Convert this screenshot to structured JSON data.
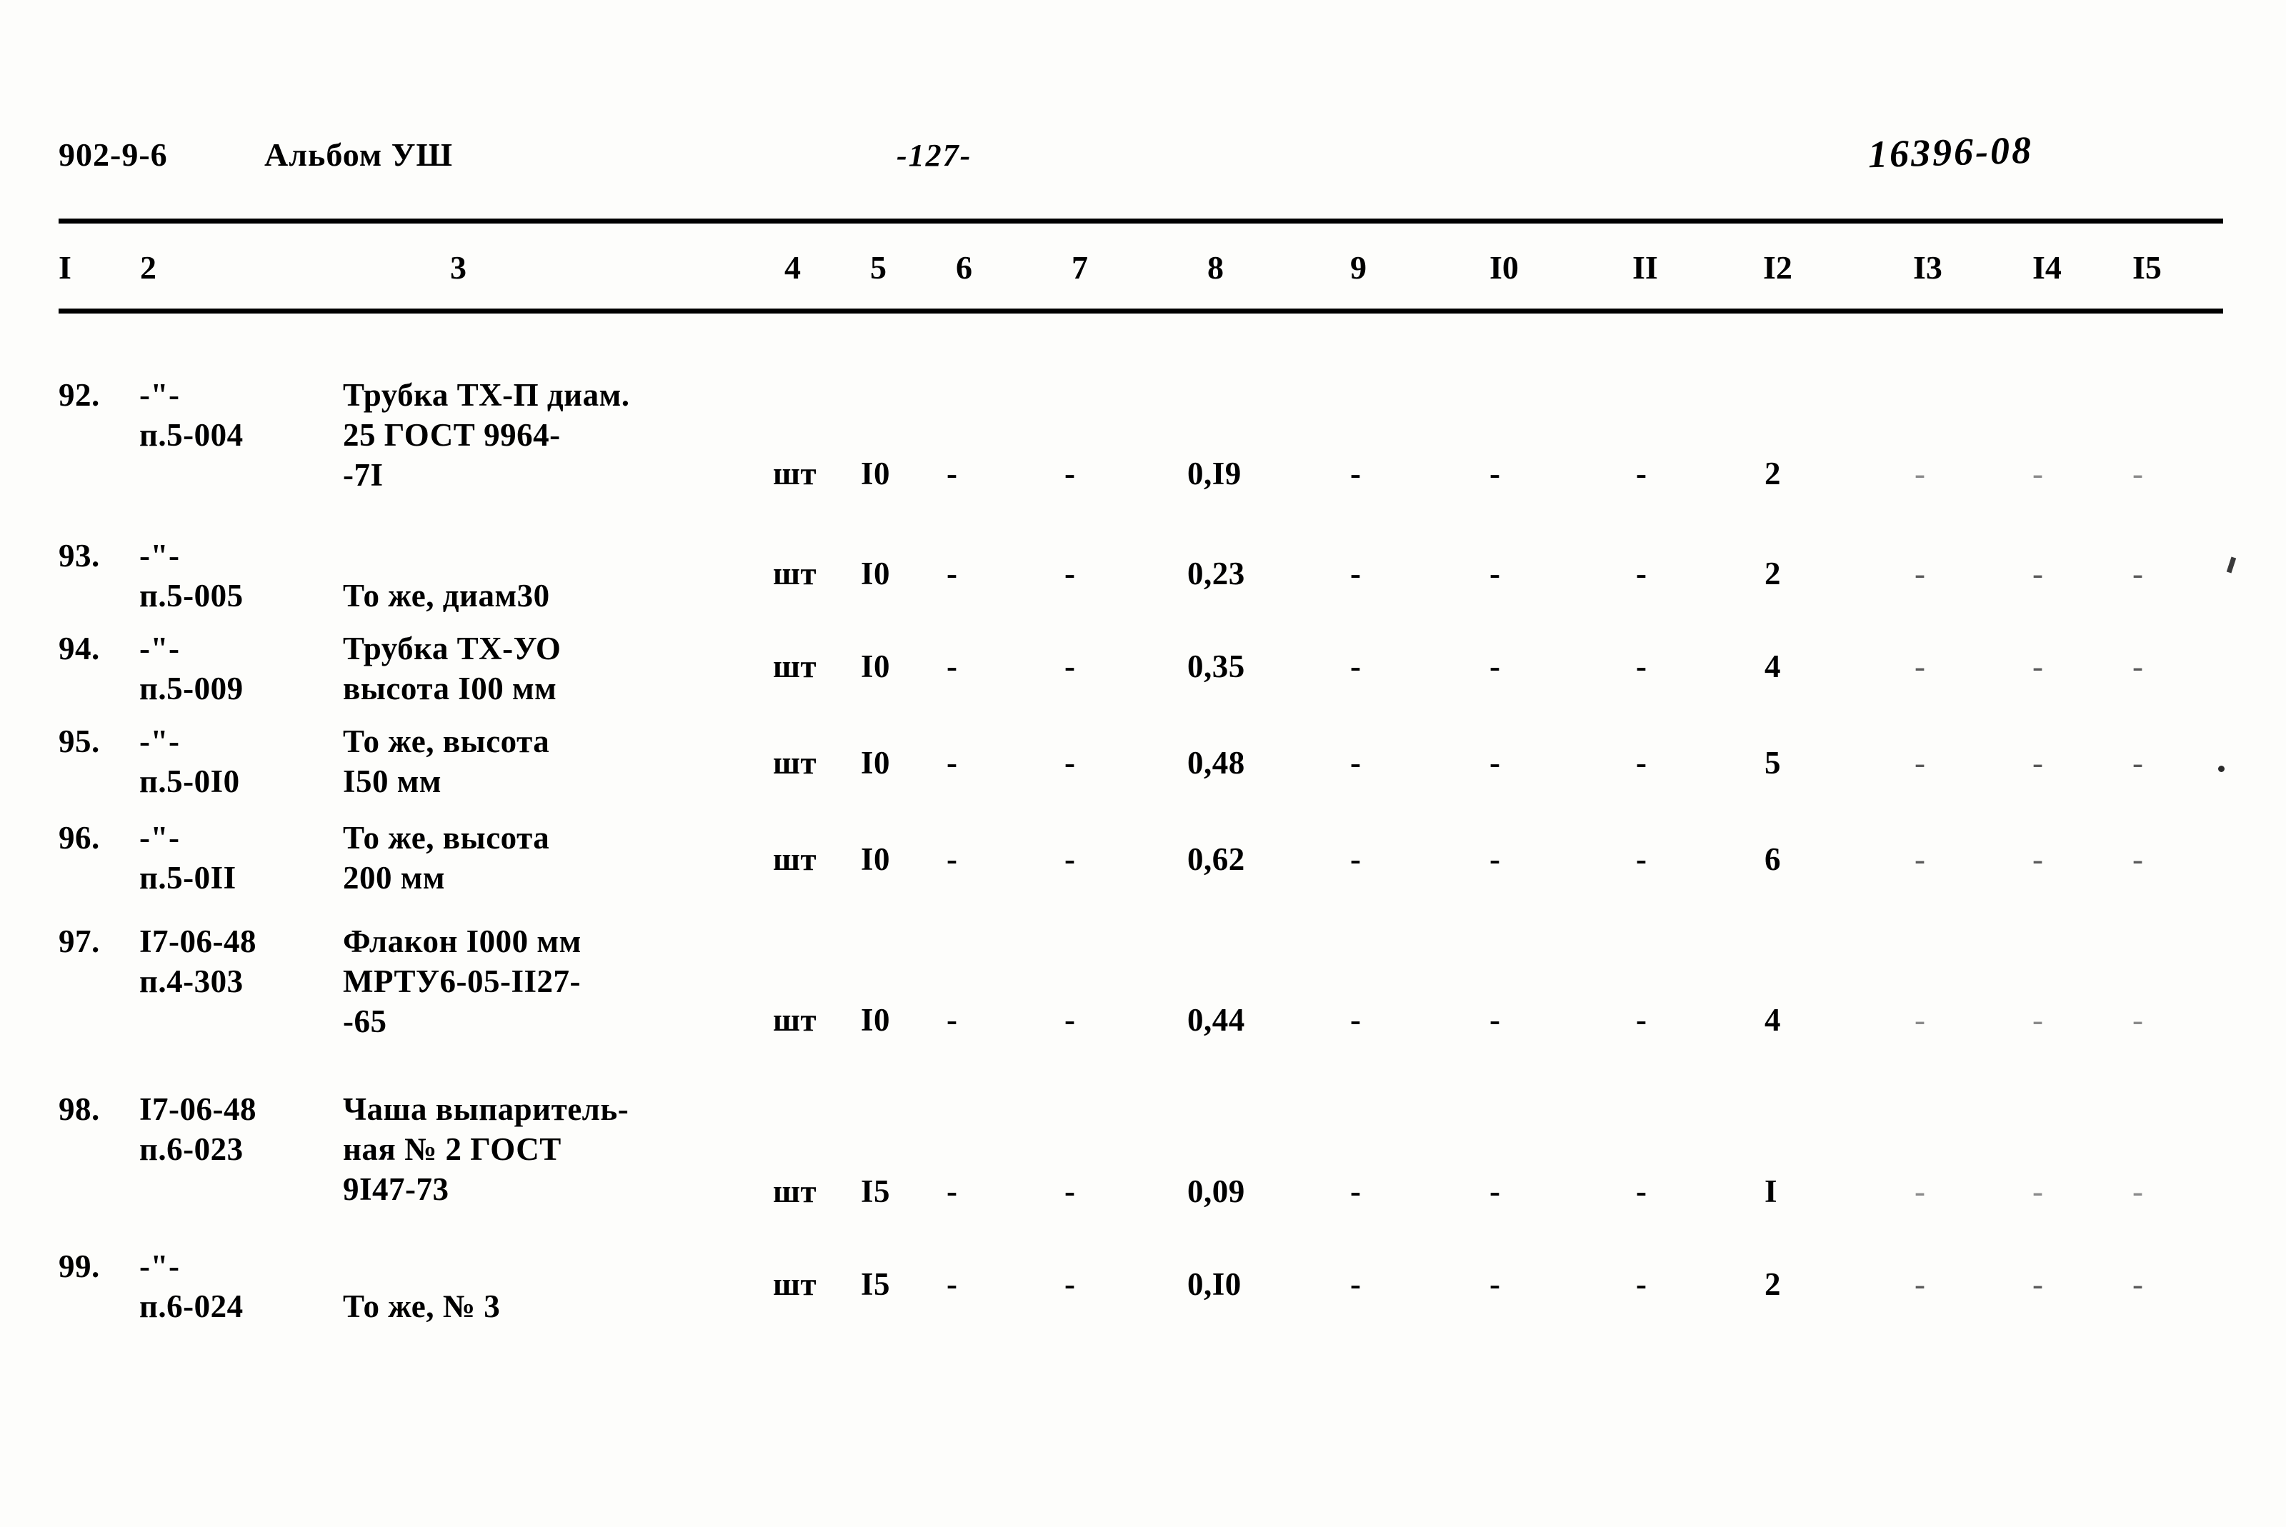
{
  "header": {
    "code": "902-9-6",
    "album": "Альбом УШ",
    "page_number": "-127-",
    "stamp": "16396-08"
  },
  "table": {
    "column_headers": [
      "I",
      "2",
      "3",
      "4",
      "5",
      "6",
      "7",
      "8",
      "9",
      "I0",
      "II",
      "I2",
      "I3",
      "I4",
      "I5"
    ],
    "rows": [
      {
        "num": "92.",
        "code_line1": "-\"-",
        "code_line2": "п.5-004",
        "name_lines": [
          "Трубка ТХ-П диам.",
          "25 ГОСТ 9964-",
          "-7I"
        ],
        "unit": "шт",
        "c5": "I0",
        "c6": "-",
        "c7": "-",
        "c8": "0,I9",
        "c9": "-",
        "c10": "-",
        "c11": "-",
        "c12": "2",
        "c13": "-",
        "c14": "-",
        "c15": "-"
      },
      {
        "num": "93.",
        "code_line1": "-\"-",
        "code_line2": "п.5-005",
        "name_lines": [
          "",
          "То же, диам30"
        ],
        "unit": "шт",
        "c5": "I0",
        "c6": "-",
        "c7": "-",
        "c8": "0,23",
        "c9": "-",
        "c10": "-",
        "c11": "-",
        "c12": "2",
        "c13": "-",
        "c14": "-",
        "c15": "-"
      },
      {
        "num": "94.",
        "code_line1": "-\"-",
        "code_line2": "п.5-009",
        "name_lines": [
          "Трубка ТХ-УО",
          "высота I00 мм"
        ],
        "unit": "шт",
        "c5": "I0",
        "c6": "-",
        "c7": "-",
        "c8": "0,35",
        "c9": "-",
        "c10": "-",
        "c11": "-",
        "c12": "4",
        "c13": "-",
        "c14": "-",
        "c15": "-"
      },
      {
        "num": "95.",
        "code_line1": "-\"-",
        "code_line2": "п.5-0I0",
        "name_lines": [
          "То же, высота",
          "I50 мм"
        ],
        "unit": "шт",
        "c5": "I0",
        "c6": "-",
        "c7": "-",
        "c8": "0,48",
        "c9": "-",
        "c10": "-",
        "c11": "-",
        "c12": "5",
        "c13": "-",
        "c14": "-",
        "c15": "-"
      },
      {
        "num": "96.",
        "code_line1": "-\"-",
        "code_line2": "п.5-0II",
        "name_lines": [
          "То же, высота",
          "200 мм"
        ],
        "unit": "шт",
        "c5": "I0",
        "c6": "-",
        "c7": "-",
        "c8": "0,62",
        "c9": "-",
        "c10": "-",
        "c11": "-",
        "c12": "6",
        "c13": "-",
        "c14": "-",
        "c15": "-"
      },
      {
        "num": "97.",
        "code_line1": "I7-06-48",
        "code_line2": "п.4-303",
        "name_lines": [
          "Флакон I000 мм",
          "МРТУ6-05-II27-",
          "-65"
        ],
        "unit": "шт",
        "c5": "I0",
        "c6": "-",
        "c7": "-",
        "c8": "0,44",
        "c9": "-",
        "c10": "-",
        "c11": "-",
        "c12": "4",
        "c13": "-",
        "c14": "-",
        "c15": "-"
      },
      {
        "num": "98.",
        "code_line1": "I7-06-48",
        "code_line2": "п.6-023",
        "name_lines": [
          "Чаша выпаритель-",
          "ная № 2 ГОСТ",
          "9I47-73"
        ],
        "unit": "шт",
        "c5": "I5",
        "c6": "-",
        "c7": "-",
        "c8": "0,09",
        "c9": "-",
        "c10": "-",
        "c11": "-",
        "c12": "I",
        "c13": "-",
        "c14": "-",
        "c15": "-"
      },
      {
        "num": "99.",
        "code_line1": "-\"-",
        "code_line2": "п.6-024",
        "name_lines": [
          "",
          "То же, № 3"
        ],
        "unit": "шт",
        "c5": "I5",
        "c6": "-",
        "c7": "-",
        "c8": "0,I0",
        "c9": "-",
        "c10": "-",
        "c11": "-",
        "c12": "2",
        "c13": "-",
        "c14": "-",
        "c15": "-"
      }
    ]
  }
}
